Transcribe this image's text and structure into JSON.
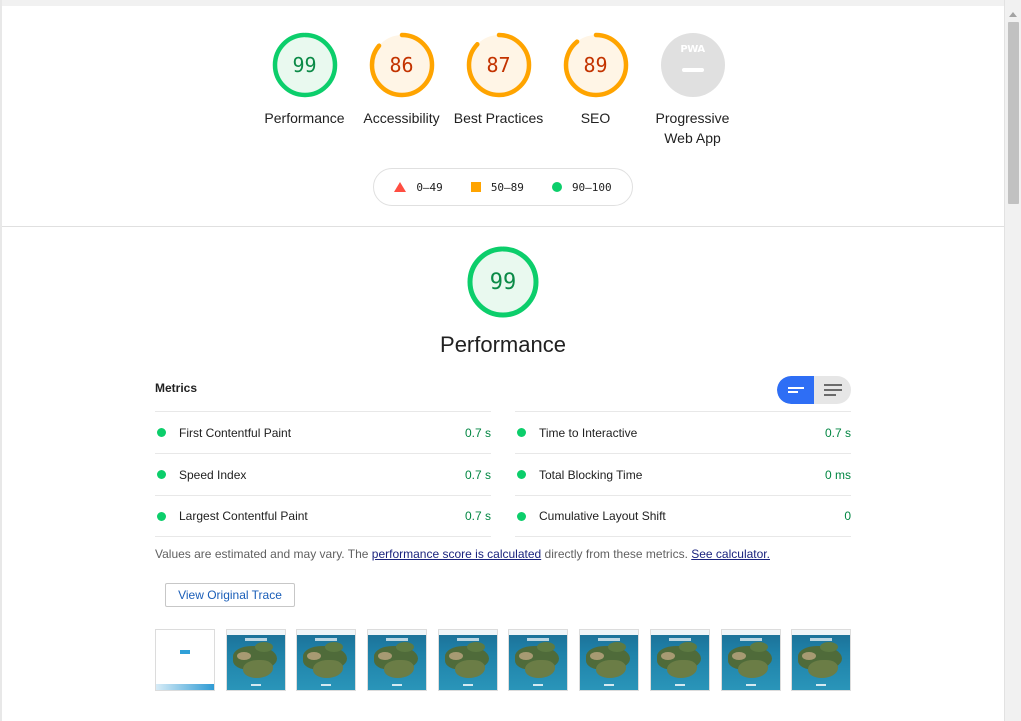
{
  "gauges": [
    {
      "score": "99",
      "label": "Performance",
      "status": "pass"
    },
    {
      "score": "86",
      "label": "Accessibility",
      "status": "average"
    },
    {
      "score": "87",
      "label": "Best Practices",
      "status": "average"
    },
    {
      "score": "89",
      "label": "SEO",
      "status": "average"
    },
    {
      "score": "",
      "label": "Progressive Web App",
      "status": "na",
      "badge": "PWA"
    }
  ],
  "legend": {
    "fail": "0–49",
    "average": "50–89",
    "pass": "90–100"
  },
  "category": {
    "score": "99",
    "title": "Performance"
  },
  "metrics": {
    "title": "Metrics",
    "items": [
      {
        "name": "First Contentful Paint",
        "value": "0.7 s"
      },
      {
        "name": "Time to Interactive",
        "value": "0.7 s"
      },
      {
        "name": "Speed Index",
        "value": "0.7 s"
      },
      {
        "name": "Total Blocking Time",
        "value": "0 ms"
      },
      {
        "name": "Largest Contentful Paint",
        "value": "0.7 s"
      },
      {
        "name": "Cumulative Layout Shift",
        "value": "0"
      }
    ]
  },
  "note": {
    "prefix": "Values are estimated and may vary. The ",
    "link1": "performance score is calculated",
    "middle": " directly from these metrics. ",
    "link2": "See calculator."
  },
  "trace_button": "View Original Trace",
  "colors": {
    "pass": "#0cce6b",
    "average": "#ffa400",
    "fail": "#ff4e42",
    "na": "#e0e0e0"
  }
}
